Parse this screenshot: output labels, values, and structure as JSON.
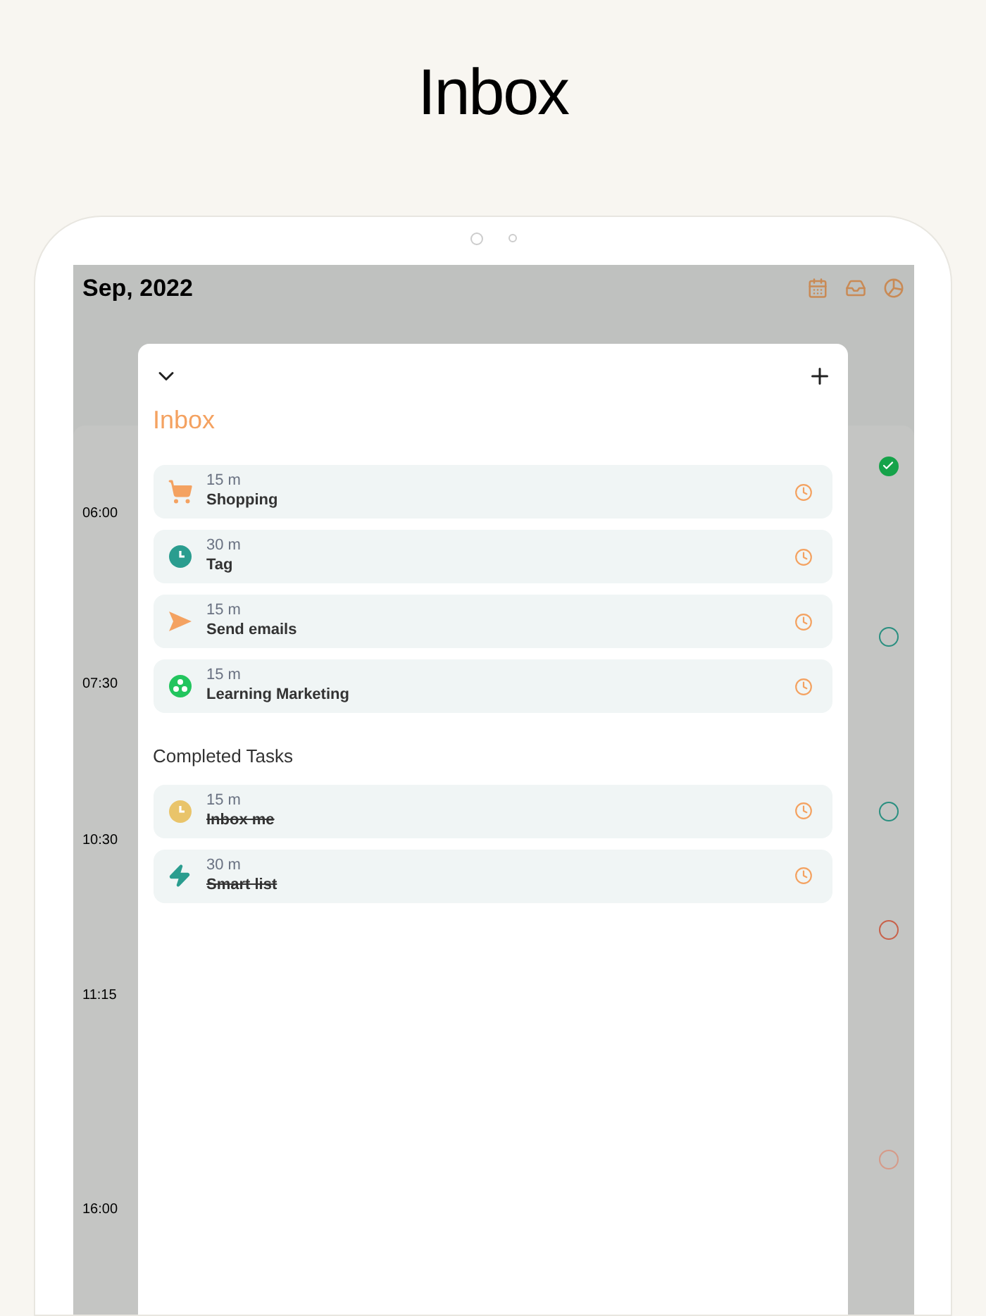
{
  "page_title": "Inbox",
  "app": {
    "month": "Sep, 2022",
    "times": [
      "06:00",
      "07:30",
      "10:30",
      "11:15",
      "16:00"
    ],
    "task_markers": [
      {
        "done": true,
        "color": "#16a34a"
      },
      {
        "done": false,
        "color": "#2a8f80"
      },
      {
        "done": false,
        "color": "#2a8f80"
      },
      {
        "done": false,
        "color": "#c8614a"
      },
      {
        "done": false,
        "color": "#d69a88"
      }
    ]
  },
  "sheet": {
    "title": "Inbox",
    "tasks": [
      {
        "kind": "cart",
        "duration": "15 m",
        "name": "Shopping",
        "completed": false
      },
      {
        "kind": "clock",
        "duration": "30 m",
        "name": "Tag",
        "completed": false
      },
      {
        "kind": "send",
        "duration": "15 m",
        "name": "Send emails",
        "completed": false
      },
      {
        "kind": "ball",
        "duration": "15 m",
        "name": "Learning Marketing",
        "completed": false
      }
    ],
    "completed_heading": "Completed Tasks",
    "completed_tasks": [
      {
        "kind": "clock-yellow",
        "duration": "15 m",
        "name": "Inbox me",
        "completed": true
      },
      {
        "kind": "bolt",
        "duration": "30 m",
        "name": "Smart list",
        "completed": true
      }
    ]
  }
}
